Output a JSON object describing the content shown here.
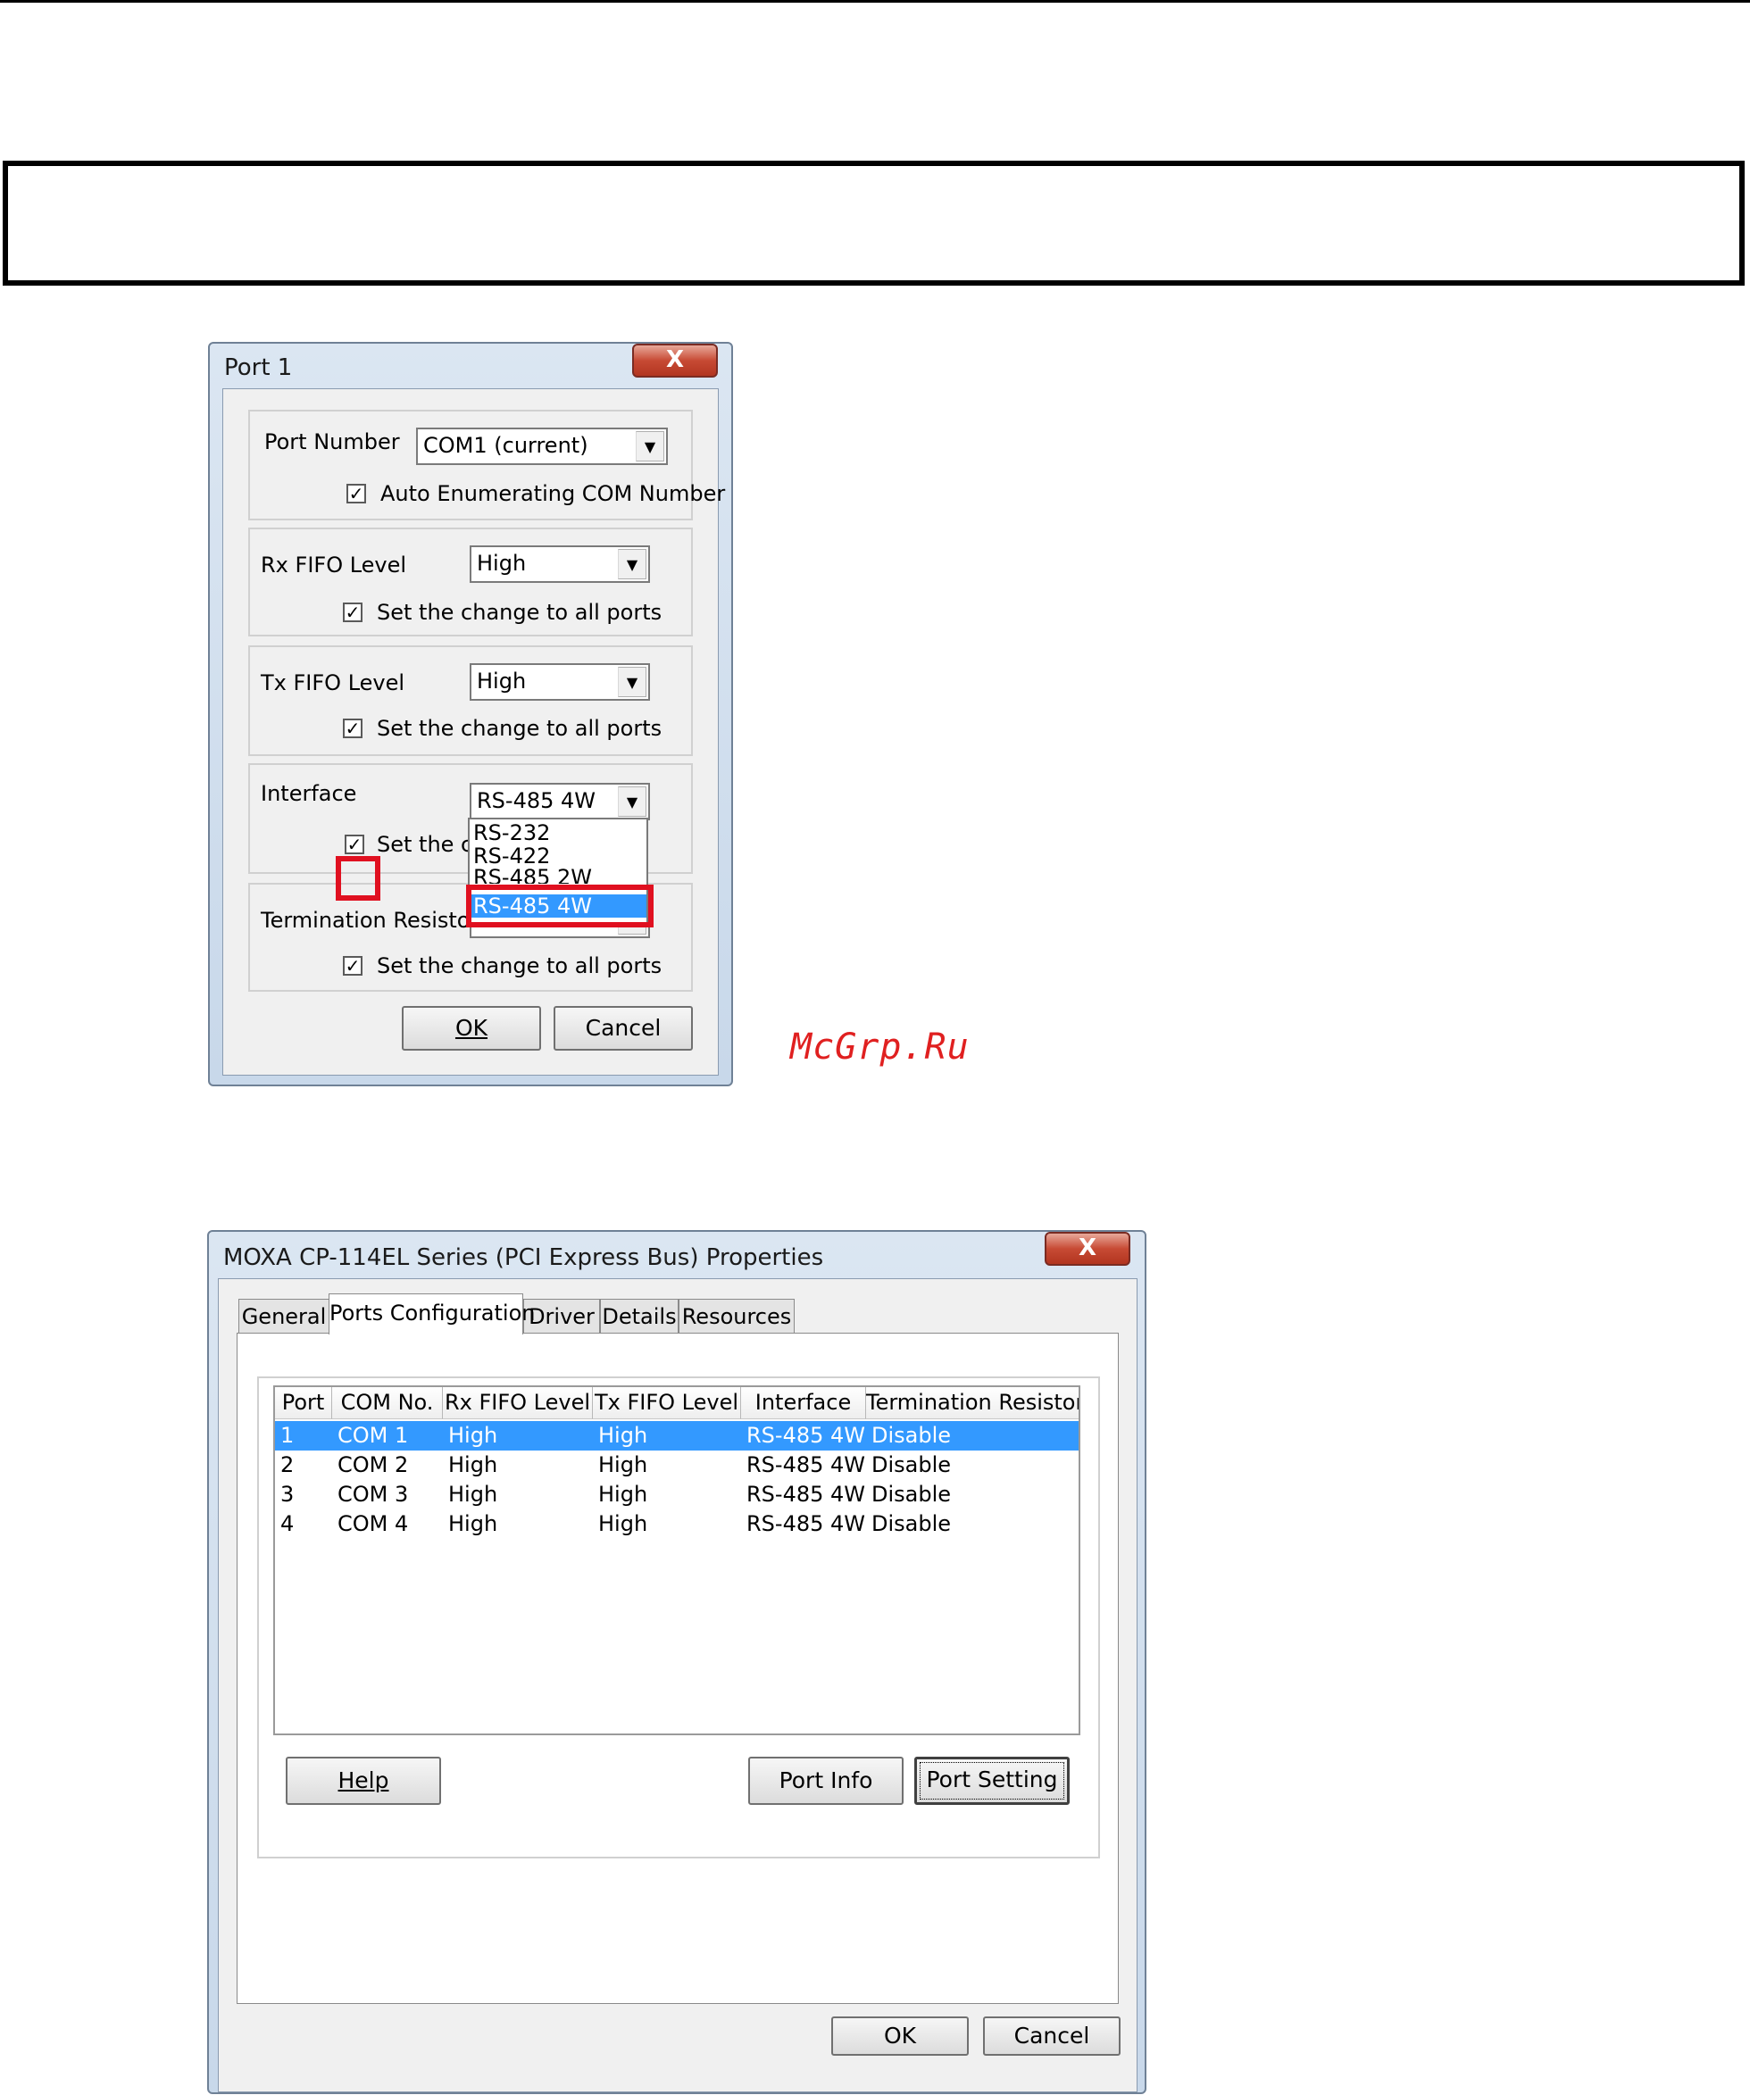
{
  "port_dialog": {
    "title": "Port 1",
    "close_label": "X",
    "port_number": {
      "label": "Port Number",
      "value": "COM1 (current)"
    },
    "auto_enum": {
      "checked": true,
      "label": "Auto Enumerating COM Number"
    },
    "rx_fifo": {
      "label": "Rx FIFO Level",
      "value": "High",
      "apply_all_label": "Set the change to all ports",
      "apply_all_checked": true
    },
    "tx_fifo": {
      "label": "Tx FIFO Level",
      "value": "High",
      "apply_all_label": "Set the change to all ports",
      "apply_all_checked": true
    },
    "interface": {
      "label": "Interface",
      "value": "RS-485 4W",
      "apply_all_label": "Set the ch",
      "apply_all_checked": true,
      "options": [
        "RS-232",
        "RS-422",
        "RS-485 2W",
        "RS-485 4W"
      ],
      "highlighted_option": "RS-485 4W"
    },
    "termination": {
      "label": "Termination Resistor",
      "apply_all_label": "Set the change to all ports",
      "apply_all_checked": true
    },
    "ok_label": "OK",
    "cancel_label": "Cancel",
    "check_glyph": "✓"
  },
  "watermark": "McGrp.Ru",
  "properties_dialog": {
    "title": "MOXA CP-114EL Series (PCI Express Bus) Properties",
    "close_label": "X",
    "tabs": [
      "General",
      "Ports Configuration",
      "Driver",
      "Details",
      "Resources"
    ],
    "active_tab": "Ports Configuration",
    "columns": [
      "Port",
      "COM No.",
      "Rx FIFO Level",
      "Tx FIFO Level",
      "Interface",
      "Termination Resistor"
    ],
    "rows": [
      {
        "port": "1",
        "com": "COM 1",
        "rx": "High",
        "tx": "High",
        "iface": "RS-485 4W",
        "term": "Disable",
        "selected": true
      },
      {
        "port": "2",
        "com": "COM 2",
        "rx": "High",
        "tx": "High",
        "iface": "RS-485 4W",
        "term": "Disable",
        "selected": false
      },
      {
        "port": "3",
        "com": "COM 3",
        "rx": "High",
        "tx": "High",
        "iface": "RS-485 4W",
        "term": "Disable",
        "selected": false
      },
      {
        "port": "4",
        "com": "COM 4",
        "rx": "High",
        "tx": "High",
        "iface": "RS-485 4W",
        "term": "Disable",
        "selected": false
      }
    ],
    "help_label": "Help",
    "port_info_label": "Port Info",
    "port_setting_label": "Port Setting",
    "ok_label": "OK",
    "cancel_label": "Cancel"
  },
  "colors": {
    "selection": "#3399ff",
    "highlight_border": "#e01020",
    "watermark": "#e02020"
  }
}
